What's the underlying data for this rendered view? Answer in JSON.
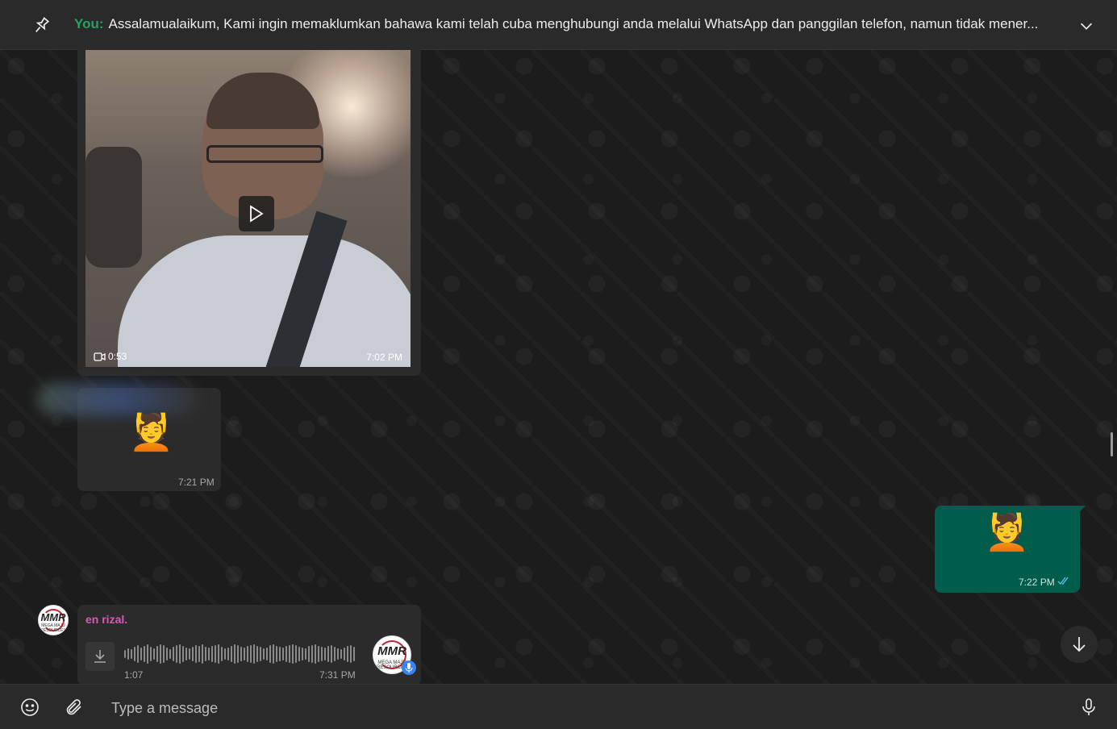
{
  "pinned": {
    "sender": "You:",
    "text": "Assalamualaikum,  Kami ingin memaklumkan bahawa kami telah cuba menghubungi anda melalui WhatsApp dan panggilan telefon, namun tidak mener..."
  },
  "video_message": {
    "duration": "0:53",
    "time": "7:02 PM"
  },
  "sticker_message_in": {
    "emoji": "💆",
    "time": "7:21 PM"
  },
  "sticker_message_out": {
    "emoji": "💆",
    "time": "7:22 PM",
    "status": "read"
  },
  "voice_message": {
    "sender": "en rizal.",
    "duration": "1:07",
    "time": "7:31 PM",
    "avatar_logo": "MMR",
    "avatar_sub": "MEGA MAJU RESOURCES"
  },
  "composer": {
    "placeholder": "Type a message"
  },
  "colors": {
    "accent_green": "#25a261",
    "outgoing_bubble": "#005c4b",
    "sender_pink": "#d65ab5",
    "read_ticks": "#53bdeb"
  }
}
